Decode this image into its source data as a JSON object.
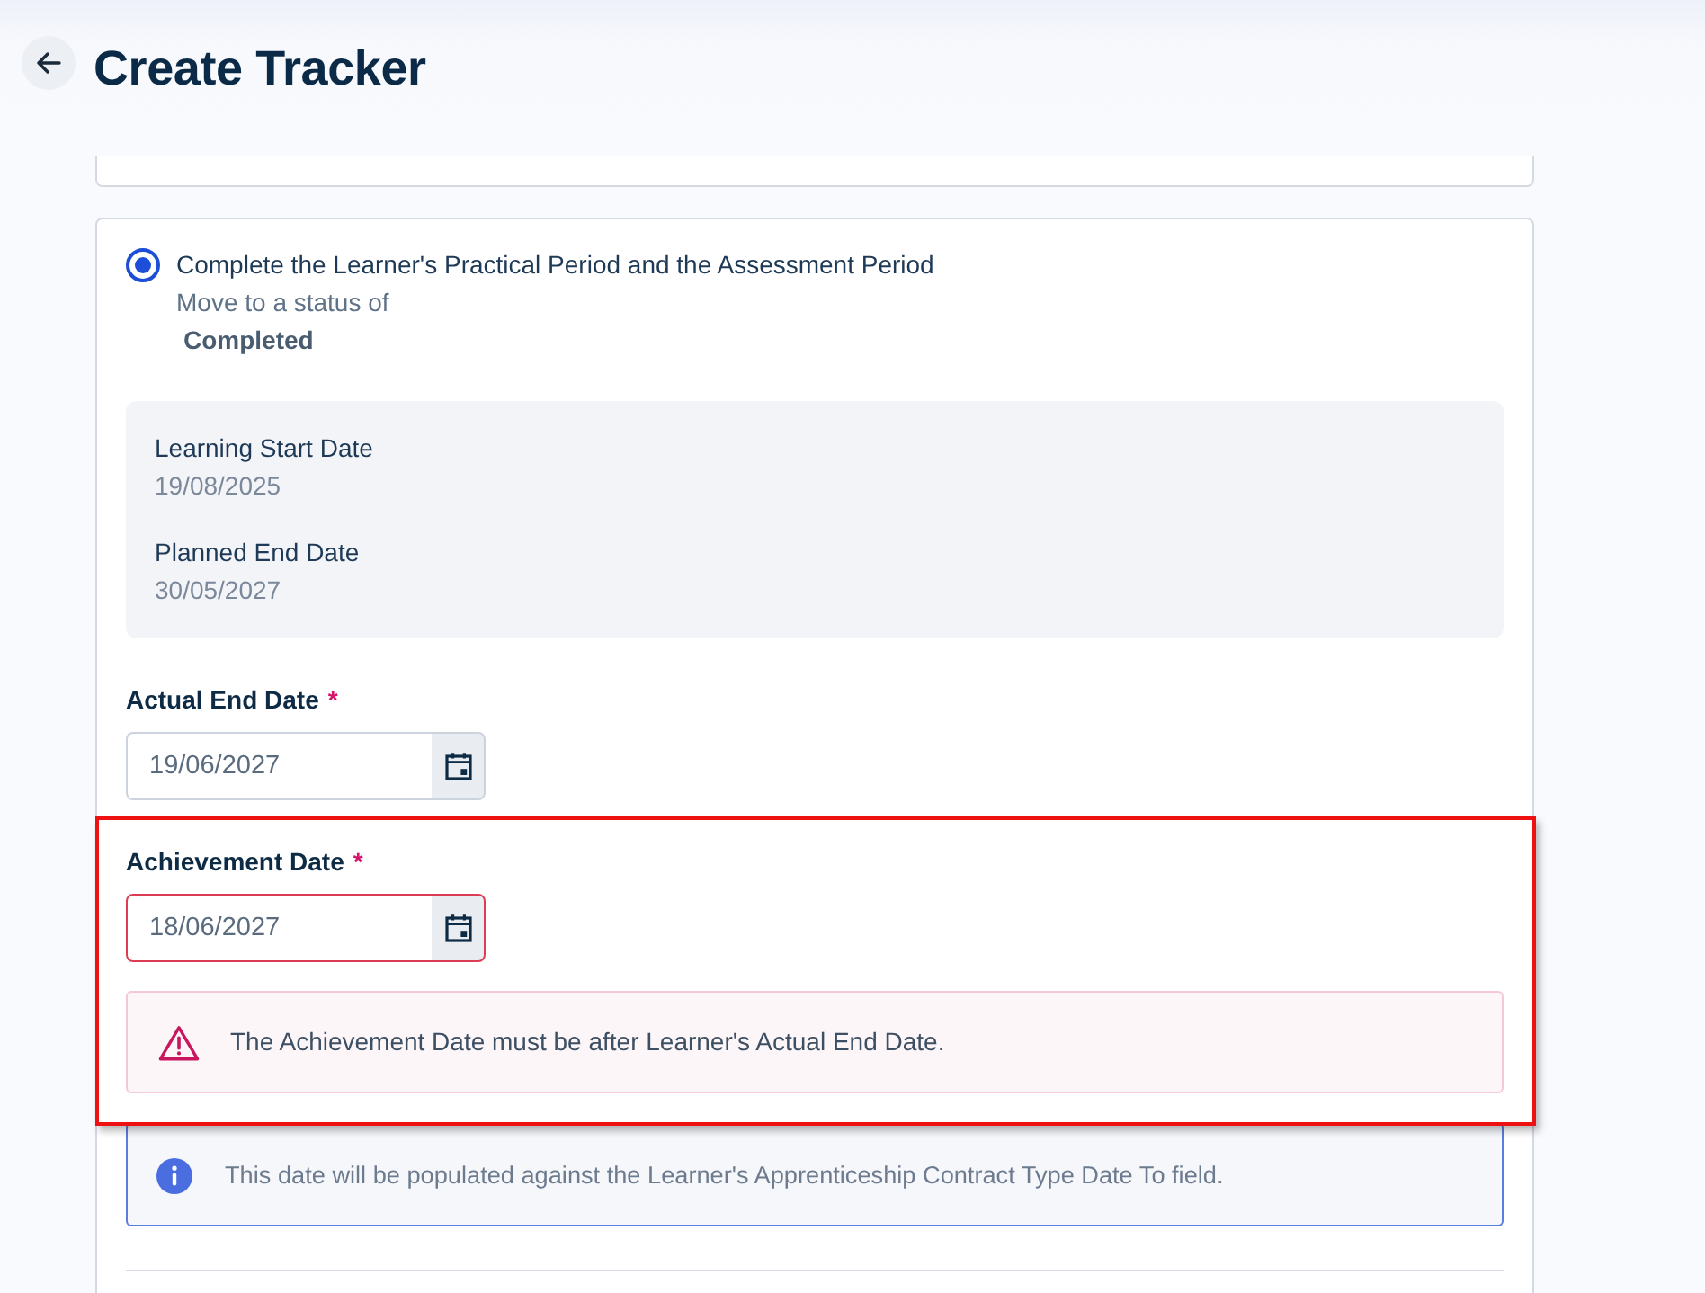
{
  "header": {
    "title": "Create Tracker"
  },
  "option": {
    "label": "Complete the Learner's Practical Period and the Assessment Period",
    "selected": true,
    "description": "Move to a status of",
    "status": "Completed"
  },
  "summary": [
    {
      "label": "Learning Start Date",
      "value": "19/08/2025"
    },
    {
      "label": "Planned End Date",
      "value": "30/05/2027"
    }
  ],
  "fields": [
    {
      "label": "Actual End Date",
      "required_mark": "*",
      "value": "19/06/2027",
      "invalid": false,
      "highlighted": false
    },
    {
      "label": "Achievement Date",
      "required_mark": "*",
      "value": "18/06/2027",
      "invalid": true,
      "highlighted": true,
      "error": "The Achievement Date must be after Learner's Actual End Date."
    }
  ],
  "info": {
    "text": "This date will be populated against the Learner's Apprenticeship Contract Type Date To field."
  }
}
